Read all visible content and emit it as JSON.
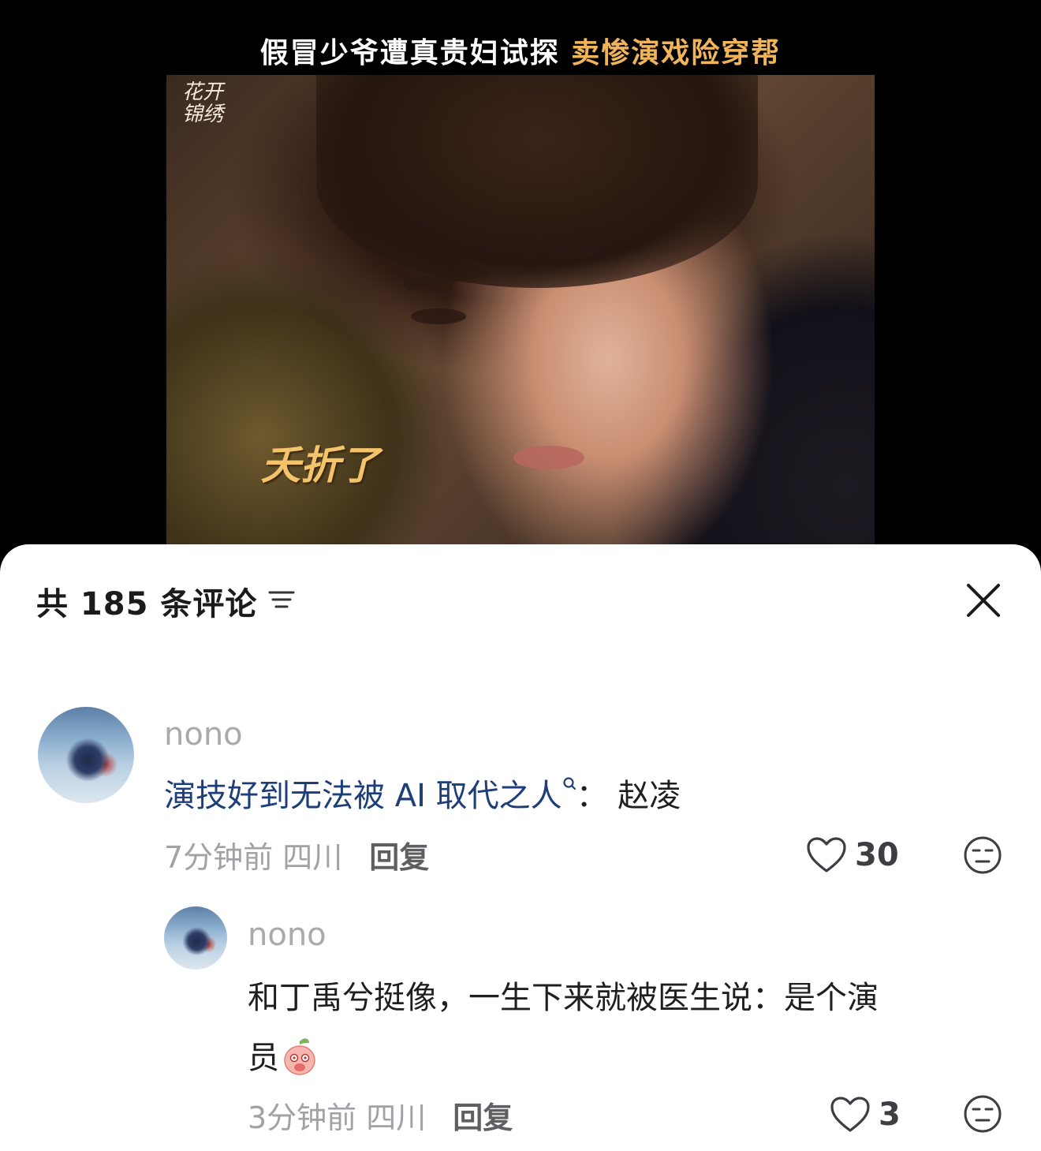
{
  "video": {
    "title_main": "假冒少爷遭真贵妇试探",
    "title_highlight": "卖惨演戏险穿帮",
    "show_logo_text": "花开锦绣",
    "subtitle": "夭折了"
  },
  "comments_panel": {
    "header": "共 185 条评论",
    "comments": [
      {
        "username": "nono",
        "search_text": "演技好到无法被 AI 取代之人",
        "text_suffix": "： 赵凌",
        "time_location": "7分钟前 四川",
        "reply_label": "回复",
        "likes": "30"
      },
      {
        "username": "nono",
        "text_line1": "和丁禹兮挺像，一生下来就被医生说：是个演",
        "text_line2": "员",
        "time_location": "3分钟前 四川",
        "reply_label": "回复",
        "likes": "3"
      }
    ]
  },
  "colors": {
    "accent_title": "#f0b45a",
    "link_blue": "#1e3e7a",
    "meta_gray": "#a1a1a6"
  },
  "icons": [
    "sort-icon",
    "close-icon",
    "heart-icon",
    "dislike-face-icon",
    "search-icon",
    "peach-emoji-icon"
  ]
}
